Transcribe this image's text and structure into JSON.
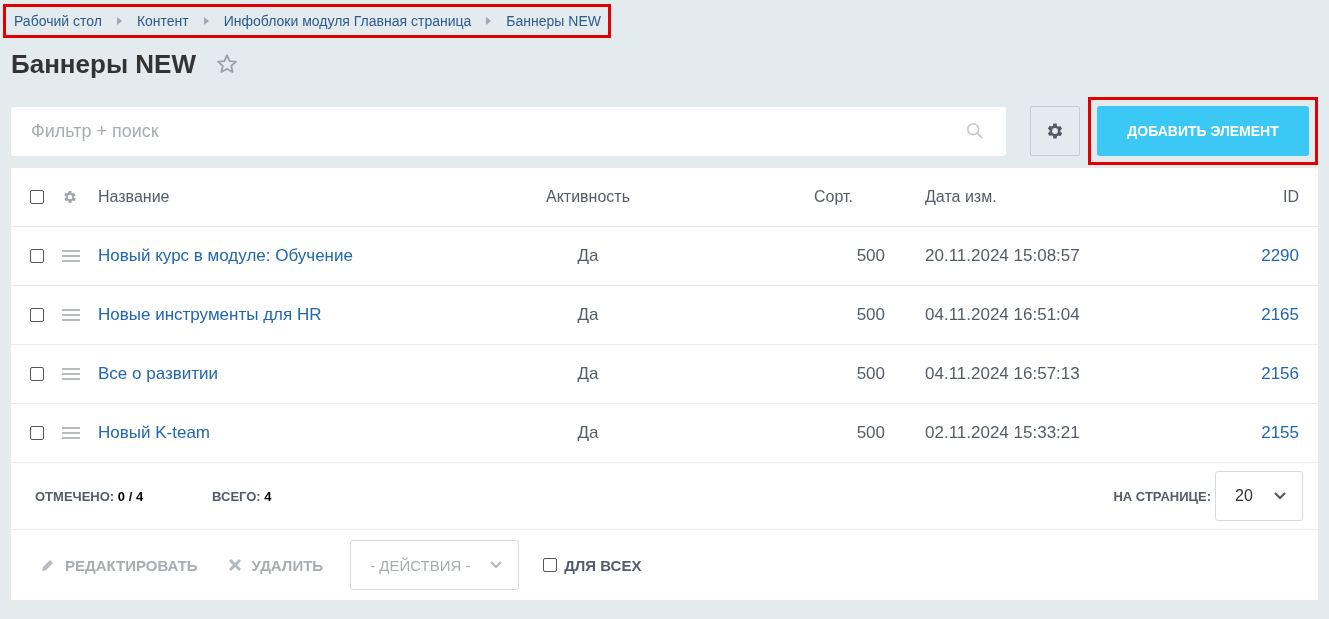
{
  "breadcrumbs": {
    "highlighted": true,
    "items": [
      "Рабочий стол",
      "Контент",
      "Инфоблоки модуля Главная страница",
      "Баннеры NEW"
    ]
  },
  "title": "Баннеры NEW",
  "favorite": false,
  "search": {
    "placeholder": "Фильтр + поиск"
  },
  "add_button": {
    "label": "ДОБАВИТЬ ЭЛЕМЕНТ",
    "highlighted": true
  },
  "table": {
    "all_checked": false,
    "columns": [
      "Название",
      "Активность",
      "Сорт.",
      "Дата изм.",
      "ID"
    ],
    "rows": [
      {
        "checked": false,
        "name": "Новый курс в модуле: Обучение",
        "active": "Да",
        "sort": "500",
        "date": "20.11.2024 15:08:57",
        "id": "2290"
      },
      {
        "checked": false,
        "name": "Новые инструменты для HR",
        "active": "Да",
        "sort": "500",
        "date": "04.11.2024 16:51:04",
        "id": "2165"
      },
      {
        "checked": false,
        "name": "Все о развитии",
        "active": "Да",
        "sort": "500",
        "date": "04.11.2024 16:57:13",
        "id": "2156"
      },
      {
        "checked": false,
        "name": "Новый K-team",
        "active": "Да",
        "sort": "500",
        "date": "02.11.2024 15:33:21",
        "id": "2155"
      }
    ]
  },
  "summary": {
    "selected_label": "ОТМЕЧЕНО:",
    "selected_value": "0 / 4",
    "total_label": "ВСЕГО:",
    "total_value": "4",
    "per_page_label": "НА СТРАНИЦЕ:",
    "per_page_value": "20"
  },
  "actions": {
    "edit": "РЕДАКТИРОВАТЬ",
    "delete": "УДАЛИТЬ",
    "select_placeholder": "- ДЕЙСТВИЯ -",
    "for_all_label": "ДЛЯ ВСЕХ",
    "for_all_checked": false
  }
}
